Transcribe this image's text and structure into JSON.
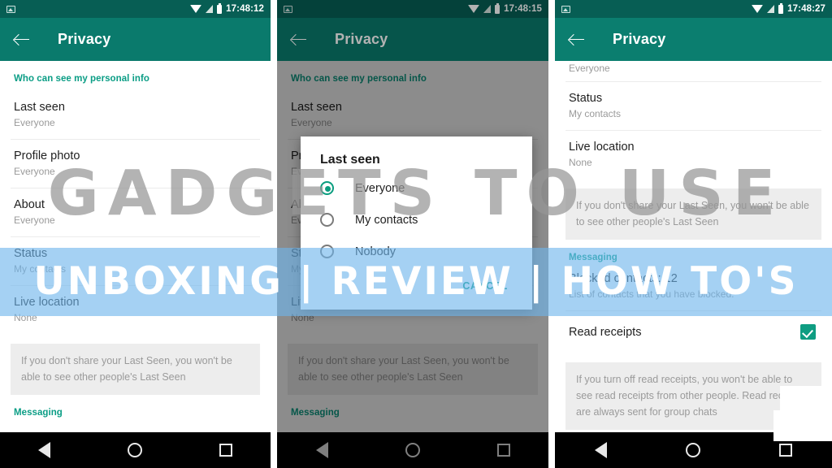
{
  "panels": [
    {
      "id": "panel-1",
      "status": {
        "time": "17:48:12",
        "photo_icon": "photo-icon",
        "wifi_icon": "wifi-icon",
        "signal_icon": "signal-icon",
        "battery_icon": "battery-icon"
      },
      "appbar": {
        "back_icon": "back-arrow-icon",
        "title": "Privacy"
      },
      "section_personal": "Who can see my personal info",
      "rows": [
        {
          "title": "Last seen",
          "sub": "Everyone"
        },
        {
          "title": "Profile photo",
          "sub": "Everyone"
        },
        {
          "title": "About",
          "sub": "Everyone"
        },
        {
          "title": "Status",
          "sub": "My contacts"
        },
        {
          "title": "Live location",
          "sub": "None"
        }
      ],
      "note": "If you don't share your Last Seen, you won't be able to see other people's Last Seen",
      "section_messaging": "Messaging"
    },
    {
      "id": "panel-2",
      "status": {
        "time": "17:48:15",
        "photo_icon": "photo-icon",
        "wifi_icon": "wifi-icon",
        "signal_icon": "signal-icon",
        "battery_icon": "battery-icon"
      },
      "appbar": {
        "back_icon": "back-arrow-icon",
        "title": "Privacy"
      },
      "section_personal": "Who can see my personal info",
      "rows": [
        {
          "title": "Last seen",
          "sub": "Everyone"
        },
        {
          "title": "Profile photo",
          "sub": "Everyone"
        },
        {
          "title": "About",
          "sub": "Everyone"
        },
        {
          "title": "Status",
          "sub": "My contacts"
        },
        {
          "title": "Live location",
          "sub": "None"
        }
      ],
      "note": "If you don't share your Last Seen, you won't be able to see other people's Last Seen",
      "section_messaging": "Messaging",
      "dialog": {
        "title": "Last seen",
        "options": [
          {
            "label": "Everyone",
            "selected": true
          },
          {
            "label": "My contacts",
            "selected": false
          },
          {
            "label": "Nobody",
            "selected": false
          }
        ],
        "cancel_label": "CANCEL"
      }
    },
    {
      "id": "panel-3",
      "status": {
        "time": "17:48:27",
        "photo_icon": "photo-icon",
        "wifi_icon": "wifi-icon",
        "signal_icon": "signal-icon",
        "battery_icon": "battery-icon"
      },
      "appbar": {
        "back_icon": "back-arrow-icon",
        "title": "Privacy"
      },
      "partial_sub": "Everyone",
      "rows": [
        {
          "title": "Status",
          "sub": "My contacts"
        },
        {
          "title": "Live location",
          "sub": "None"
        }
      ],
      "note": "If you don't share your Last Seen, you won't be able to see other people's Last Seen",
      "section_messaging": "Messaging",
      "blocked": {
        "title": "Blocked contacts: 12",
        "sub": "List of contacts that you have blocked."
      },
      "read_receipts": {
        "title": "Read receipts",
        "checked": true,
        "check_icon": "checkmark-icon"
      },
      "note2": "If you turn off read receipts, you won't be able to see read receipts from other people. Read receipts are always sent for group chats"
    }
  ],
  "navbar": {
    "back_icon": "nav-back-icon",
    "home_icon": "nav-home-icon",
    "recents_icon": "nav-recents-icon"
  },
  "watermark": {
    "main": "GADGETS TO USE",
    "band": "UNBOXING | REVIEW | HOW TO'S"
  },
  "colors": {
    "header_green": "#0a7a6c",
    "status_green": "#075e54",
    "accent_teal": "#0a9d85",
    "checkbox_green": "#0f9d82",
    "note_bg": "#ededed",
    "band_blue": "#6eb4eb"
  }
}
